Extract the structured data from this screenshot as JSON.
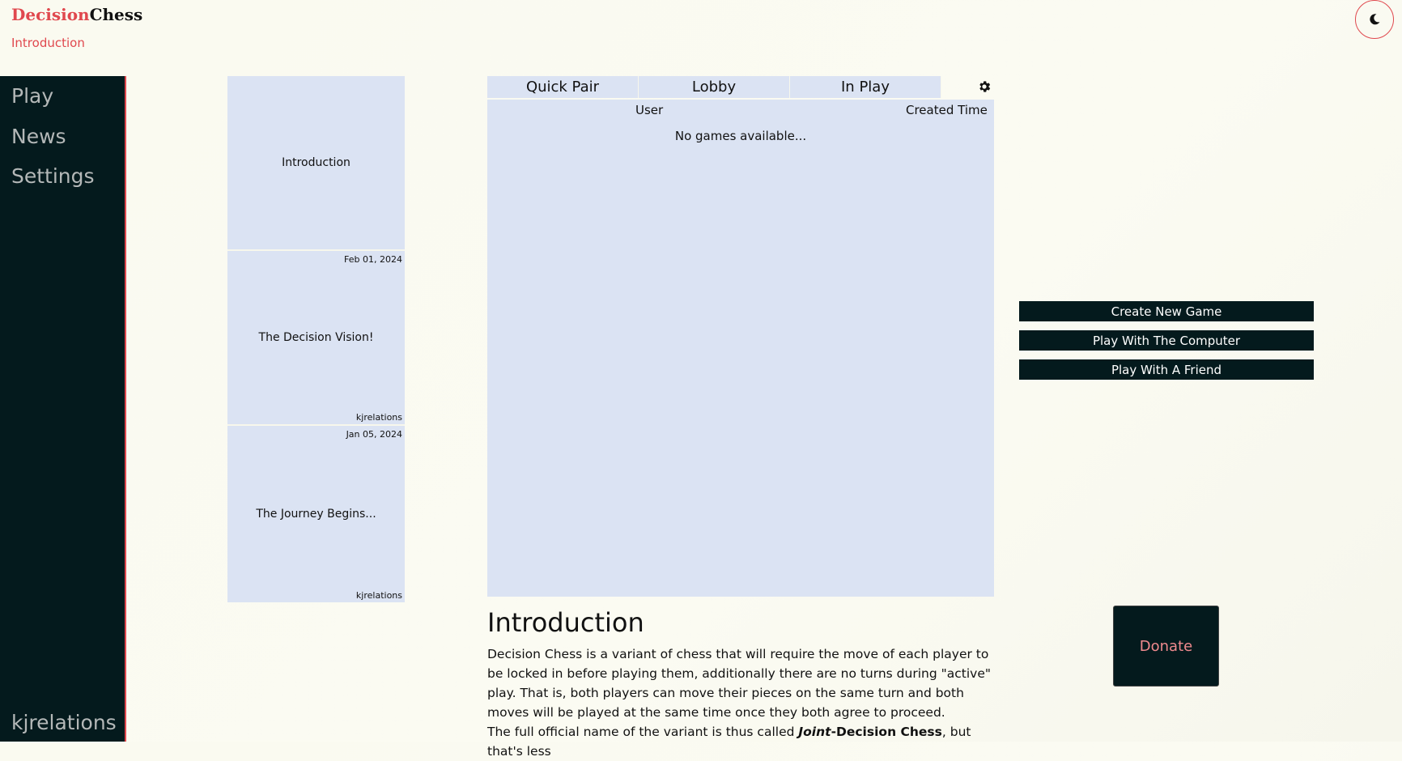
{
  "header": {
    "brand_part1": "Decision",
    "brand_part2": "Chess",
    "breadcrumb": "Introduction",
    "theme_icon": "moon-icon"
  },
  "sidebar": {
    "items": [
      {
        "label": "Play"
      },
      {
        "label": "News"
      },
      {
        "label": "Settings"
      }
    ],
    "user": "kjrelations"
  },
  "news": [
    {
      "date": "",
      "title": "Introduction",
      "author": ""
    },
    {
      "date": "Feb 01, 2024",
      "title": "The Decision Vision!",
      "author": "kjrelations"
    },
    {
      "date": "Jan 05, 2024",
      "title": "The Journey Begins...",
      "author": "kjrelations"
    }
  ],
  "lobby": {
    "tabs": [
      {
        "label": "Quick Pair"
      },
      {
        "label": "Lobby"
      },
      {
        "label": "In Play"
      }
    ],
    "settings_icon": "gear-icon",
    "columns": {
      "user": "User",
      "created": "Created Time"
    },
    "empty_text": "No games available..."
  },
  "article": {
    "heading": "Introduction",
    "para1": "Decision Chess is a variant of chess that will require the move of each player to be locked in before playing them, additionally there are no turns during \"active\" play. That is, both players can move their pieces on the same turn and both moves will be played at the same time once they both agree to proceed.",
    "para2_start": "The full official name of the variant is thus called ",
    "para2_emph1": "Joint",
    "para2_emph2": "-Decision Chess",
    "para2_end": ", but that's less"
  },
  "actions": {
    "create": "Create New Game",
    "computer": "Play With The Computer",
    "friend": "Play With A Friend"
  },
  "donate": "Donate",
  "colors": {
    "accent": "#e0484e",
    "dark": "#041a1d",
    "panel": "#dbe3f3",
    "background": "#fafaf0"
  }
}
